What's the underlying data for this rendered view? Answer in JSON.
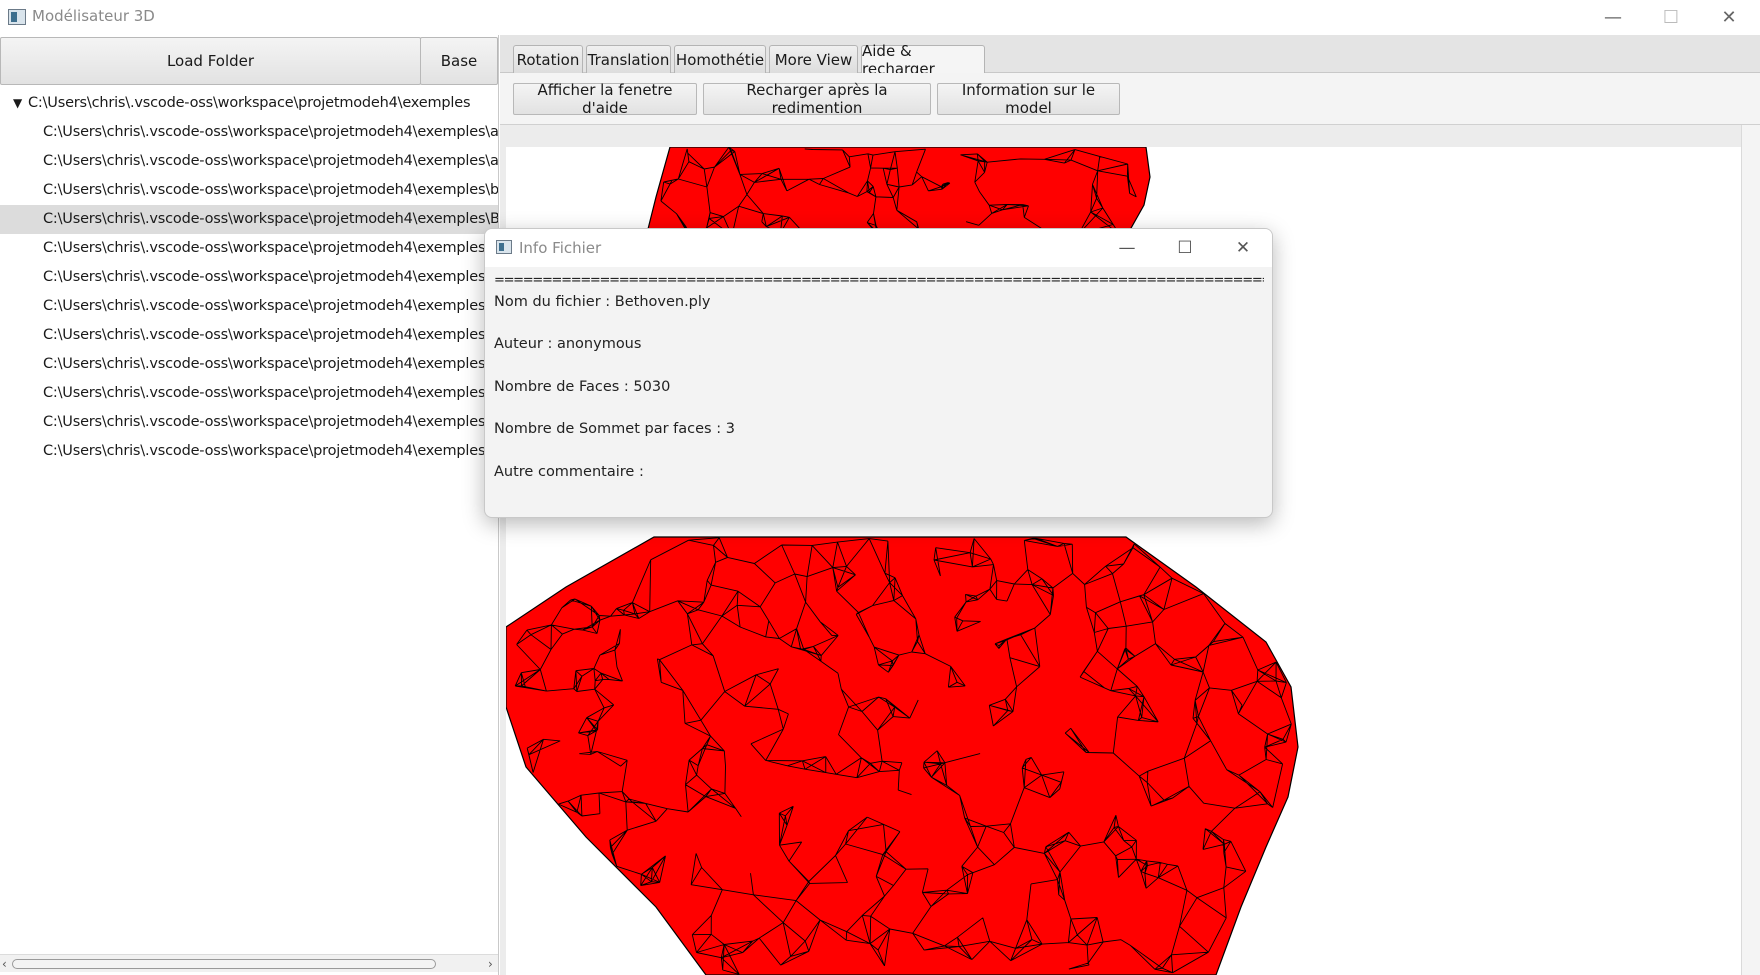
{
  "window": {
    "title": "Modélisateur 3D",
    "minimize_glyph": "—",
    "maximize_glyph": "☐",
    "close_glyph": "✕"
  },
  "left_panel": {
    "load_folder_label": "Load Folder",
    "base_label": "Base",
    "tree": {
      "root": "C:\\Users\\chris\\.vscode-oss\\workspace\\projetmodeh4\\exemples",
      "items": [
        "C:\\Users\\chris\\.vscode-oss\\workspace\\projetmodeh4\\exemples\\ant.p",
        "C:\\Users\\chris\\.vscode-oss\\workspace\\projetmodeh4\\exemples\\apple",
        "C:\\Users\\chris\\.vscode-oss\\workspace\\projetmodeh4\\exemples\\batea",
        "C:\\Users\\chris\\.vscode-oss\\workspace\\projetmodeh4\\exemples\\Betho",
        "C:\\Users\\chris\\.vscode-oss\\workspace\\projetmodeh4\\exemples\\bo",
        "C:\\Users\\chris\\.vscode-oss\\workspace\\projetmodeh4\\exemples\\cla",
        "C:\\Users\\chris\\.vscode-oss\\workspace\\projetmodeh4\\exemples\\cov",
        "C:\\Users\\chris\\.vscode-oss\\workspace\\projetmodeh4\\exemples\\cub",
        "C:\\Users\\chris\\.vscode-oss\\workspace\\projetmodeh4\\exemples\\lam",
        "C:\\Users\\chris\\.vscode-oss\\workspace\\projetmodeh4\\exemples\\mu",
        "C:\\Users\\chris\\.vscode-oss\\workspace\\projetmodeh4\\exemples\\sha",
        "C:\\Users\\chris\\.vscode-oss\\workspace\\projetmodeh4\\exemples\\spi"
      ],
      "selected_index": 3
    }
  },
  "tabs": [
    {
      "label": "Rotation"
    },
    {
      "label": "Translation"
    },
    {
      "label": "Homothétie"
    },
    {
      "label": "More View"
    },
    {
      "label": "Aide & recharger"
    }
  ],
  "active_tab": 4,
  "toolbar": {
    "help_window_label": "Afficher la fenetre d'aide",
    "reload_label": "Recharger après la redimention",
    "model_info_label": "Information sur le model"
  },
  "dialog": {
    "title": "Info Fichier",
    "separator": "==================================================================================",
    "lines": [
      "Nom du fichier : Bethoven.ply",
      "Auteur : anonymous",
      "Nombre de Faces : 5030",
      "Nombre de Sommet par faces : 3",
      "Autre commentaire :"
    ]
  },
  "colors": {
    "model_fill": "#ff0000",
    "model_edges": "#000000",
    "selection": "#dcdcdc"
  }
}
